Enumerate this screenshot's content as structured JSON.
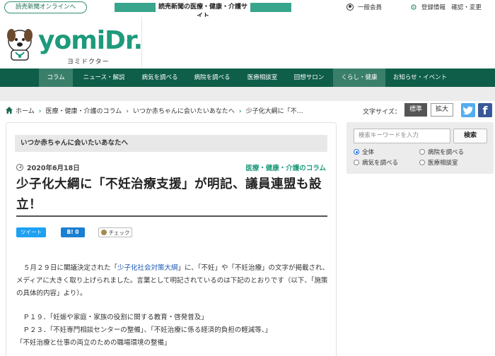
{
  "header": {
    "online_link": "読売新聞オンラインへ",
    "tagline": "読売新聞の医療・健康・介護サイト",
    "member_label": "一般会員",
    "settings_label": "登録情報　確認・変更"
  },
  "logo": {
    "text": "yomiDr.",
    "sub": "ヨミドクター"
  },
  "nav": {
    "items": [
      "コラム",
      "ニュース・解説",
      "病気を調べる",
      "病院を調べる",
      "医療相談室",
      "回想サロン",
      "くらし・健康",
      "お知らせ・イベント"
    ]
  },
  "breadcrumb": {
    "items": [
      "ホーム",
      "医療・健康・介護のコラム",
      "いつか赤ちゃんに会いたいあなたへ",
      "少子化大綱に「不…"
    ]
  },
  "text_size": {
    "label": "文字サイズ：",
    "standard": "標準",
    "large": "拡大"
  },
  "article": {
    "series": "いつか赤ちゃんに会いたいあなたへ",
    "date": "2020年6月18日",
    "category": "医療・健康・介護のコラム",
    "headline": "少子化大綱に「不妊治療支援」が明記、議員連盟も設立！",
    "share": {
      "tweet": "ツイート",
      "hatena": "B! 0",
      "check": "チェック"
    },
    "p1_before": "５月２９日に閣議決定された「",
    "p1_link": "少子化社会対策大綱",
    "p1_after": "」に、「不妊」や「不妊治療」の文字が掲載され、メディアに大きく取り上げられました。言葉として明記されているのは下記のとおりです（以下、「施策の具体的内容」より）。",
    "list": [
      "　Ｐ１９．「妊娠や家庭・家族の役割に関する教育・啓発普及」",
      "　Ｐ２３．「不妊専門相談センターの整備」、「不妊治療に係る経済的負担の軽減等、」",
      "「不妊治療と仕事の両立のための職場環境の整備」"
    ]
  },
  "sidebar": {
    "search_placeholder": "検索キーワードを入力",
    "search_button": "検索",
    "options": [
      "全体",
      "病院を調べる",
      "病気を調べる",
      "医療相談室"
    ],
    "selected": "全体"
  },
  "colors": {
    "brand_green": "#1e9a7c",
    "nav_green": "#0f5e49",
    "link_blue": "#1a5ab5"
  }
}
